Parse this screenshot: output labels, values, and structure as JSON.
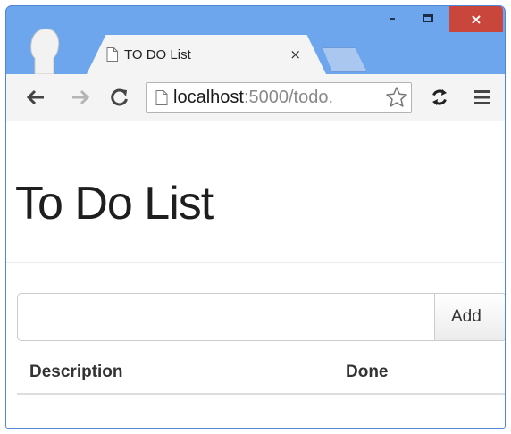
{
  "browser": {
    "tab": {
      "title": "TO DO List",
      "close_glyph": "×"
    },
    "window_controls": {
      "minimize": "–",
      "close": "×"
    },
    "address_bar": {
      "host": "localhost",
      "rest": ":5000/todo."
    },
    "icons": [
      "profile-icon",
      "page-icon",
      "back-arrow-icon",
      "forward-arrow-icon",
      "reload-icon",
      "star-icon",
      "sync-icon",
      "menu-icon"
    ],
    "colors": {
      "frame": "#6ea6ee",
      "close": "#c9463d",
      "toolbar": "#f4f4f4"
    }
  },
  "page": {
    "title": "To Do List",
    "form": {
      "input_value": "",
      "add_label": "Add"
    },
    "table": {
      "headers": [
        "Description",
        "Done"
      ],
      "rows": []
    }
  }
}
